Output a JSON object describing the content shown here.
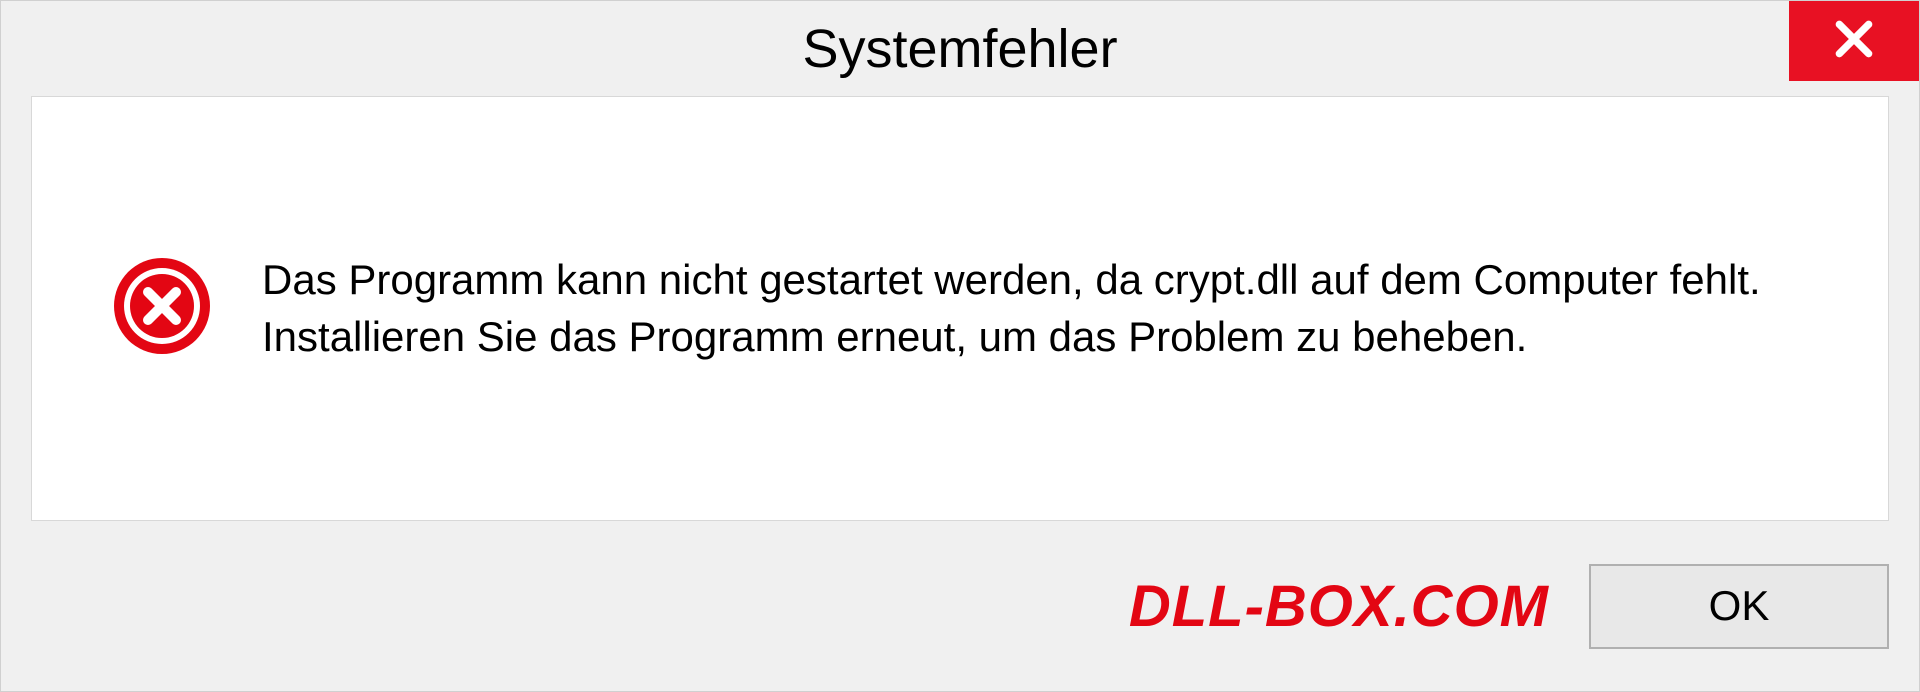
{
  "dialog": {
    "title": "Systemfehler",
    "message": "Das Programm kann nicht gestartet werden, da crypt.dll auf dem Computer fehlt. Installieren Sie das Programm erneut, um das Problem zu beheben.",
    "ok_label": "OK"
  },
  "watermark": "DLL-BOX.COM"
}
